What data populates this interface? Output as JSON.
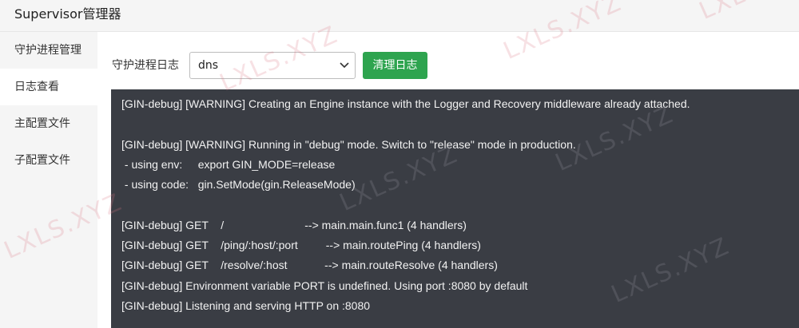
{
  "header": {
    "title": "Supervisor管理器"
  },
  "sidebar": {
    "items": [
      {
        "label": "守护进程管理",
        "active": false
      },
      {
        "label": "日志查看",
        "active": true
      },
      {
        "label": "主配置文件",
        "active": false
      },
      {
        "label": "子配置文件",
        "active": false
      }
    ]
  },
  "toolbar": {
    "label": "守护进程日志",
    "select": {
      "value": "dns"
    },
    "clear_button_label": "清理日志",
    "clear_button_color": "#2ea44f"
  },
  "console": {
    "background": "#3a3d44",
    "lines": [
      "[GIN-debug] [WARNING] Creating an Engine instance with the Logger and Recovery middleware already attached.",
      "",
      "[GIN-debug] [WARNING] Running in \"debug\" mode. Switch to \"release\" mode in production.",
      " - using env:     export GIN_MODE=release",
      " - using code:   gin.SetMode(gin.ReleaseMode)",
      "",
      "[GIN-debug] GET    /                          --> main.main.func1 (4 handlers)",
      "[GIN-debug] GET    /ping/:host/:port         --> main.routePing (4 handlers)",
      "[GIN-debug] GET    /resolve/:host            --> main.routeResolve (4 handlers)",
      "[GIN-debug] Environment variable PORT is undefined. Using port :8080 by default",
      "[GIN-debug] Listening and serving HTTP on :8080"
    ]
  },
  "watermark": {
    "text": "LXLS.XYZ"
  }
}
